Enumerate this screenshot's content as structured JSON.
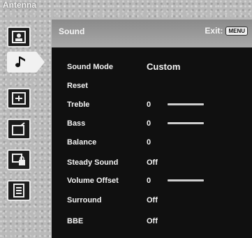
{
  "source_label": "Antenna",
  "header": {
    "title": "Sound",
    "exit_label": "Exit:",
    "menu_key": "MENU"
  },
  "sidebar": {
    "items": [
      {
        "icon": "picture-icon",
        "active": false
      },
      {
        "icon": "music-note-icon",
        "active": true
      },
      {
        "icon": "screen-adjust-icon",
        "active": false
      },
      {
        "icon": "tv-setup-icon",
        "active": false
      },
      {
        "icon": "lock-icon",
        "active": false
      },
      {
        "icon": "options-icon",
        "active": false
      }
    ]
  },
  "settings": [
    {
      "label": "Sound Mode",
      "value": "Custom",
      "slider_level": null
    },
    {
      "label": "Reset",
      "value": "",
      "slider_level": null
    },
    {
      "label": "Treble",
      "value": "0",
      "slider_level": 0.5
    },
    {
      "label": "Bass",
      "value": "0",
      "slider_level": 0.5
    },
    {
      "label": "Balance",
      "value": "0",
      "slider_level": null
    },
    {
      "label": "Steady Sound",
      "value": "Off",
      "slider_level": null
    },
    {
      "label": "Volume Offset",
      "value": "0",
      "slider_level": 0.5
    },
    {
      "label": "Surround",
      "value": "Off",
      "slider_level": null
    },
    {
      "label": "BBE",
      "value": "Off",
      "slider_level": null
    }
  ],
  "colors": {
    "panel": "#101010",
    "text": "#f3f3f3",
    "header_bar": "#9a9a9a",
    "background": "#b9b9b9"
  }
}
